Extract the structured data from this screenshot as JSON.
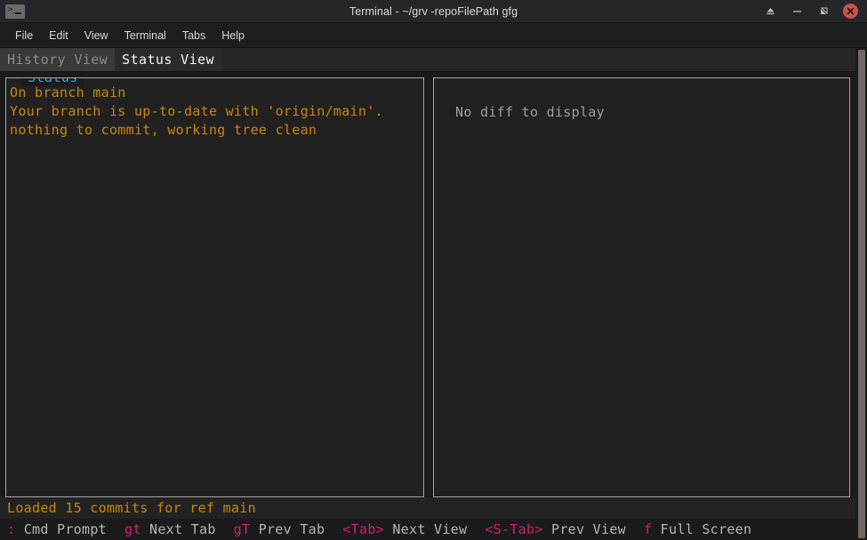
{
  "window": {
    "title": "Terminal - ~/grv -repoFilePath gfg",
    "app_icon": "terminal-icon",
    "prompt_glyph": ">_",
    "controls": [
      {
        "name": "eject-button",
        "glyph": "eject"
      },
      {
        "name": "minimize-button",
        "glyph": "minus"
      },
      {
        "name": "maximize-button",
        "glyph": "restore"
      },
      {
        "name": "close-button",
        "glyph": "x"
      }
    ],
    "accent_close": "#c9524f"
  },
  "menubar": {
    "items": [
      {
        "label": "File"
      },
      {
        "label": "Edit"
      },
      {
        "label": "View"
      },
      {
        "label": "Terminal"
      },
      {
        "label": "Tabs"
      },
      {
        "label": "Help"
      }
    ]
  },
  "tabs": [
    {
      "label": "History View",
      "active": false
    },
    {
      "label": "Status View",
      "active": true
    }
  ],
  "panes": {
    "status": {
      "title": "Status",
      "title_color": "#14b5c4",
      "text_color": "#c8860d",
      "lines": [
        "On branch main",
        "Your branch is up-to-date with 'origin/main'.",
        "nothing to commit, working tree clean"
      ]
    },
    "diff": {
      "empty_message": "No diff to display",
      "text_color": "#9e9e9e"
    }
  },
  "statusbar": {
    "message": "Loaded 15 commits for ref main",
    "message_color": "#c8860d"
  },
  "helpbar": {
    "key_color": "#d21c73",
    "desc_color": "#b6b6b6",
    "entries": [
      {
        "key": ":",
        "desc": "Cmd Prompt"
      },
      {
        "key": "gt",
        "desc": "Next Tab"
      },
      {
        "key": "gT",
        "desc": "Prev Tab"
      },
      {
        "key": "<Tab>",
        "desc": "Next View"
      },
      {
        "key": "<S-Tab>",
        "desc": "Prev View"
      },
      {
        "key": "f",
        "desc": "Full Screen"
      }
    ]
  },
  "scrollbar": {
    "name": "terminal-scrollbar"
  }
}
